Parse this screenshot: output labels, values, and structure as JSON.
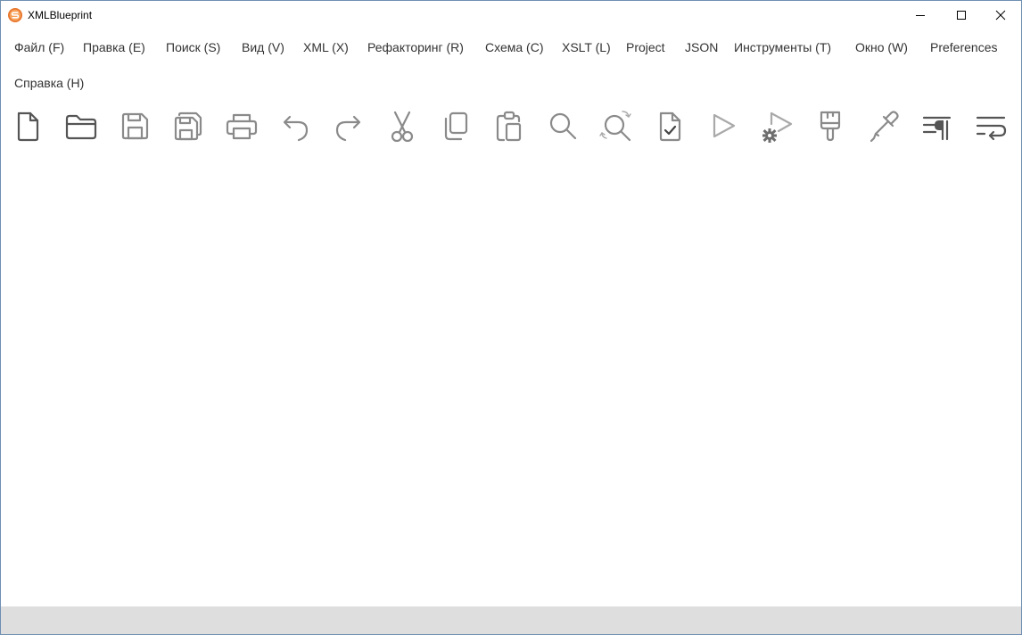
{
  "window": {
    "title": "XMLBlueprint",
    "accent_color": "#e8762c"
  },
  "menu": {
    "items": [
      {
        "label": "Файл (F)"
      },
      {
        "label": "Правка (E)"
      },
      {
        "label": "Поиск (S)"
      },
      {
        "label": "Вид (V)"
      },
      {
        "label": "XML (X)"
      },
      {
        "label": "Рефакторинг (R)"
      },
      {
        "label": "Схема (C)"
      },
      {
        "label": "XSLT (L)"
      },
      {
        "label": "Project"
      },
      {
        "label": "JSON"
      },
      {
        "label": "Инструменты (T)"
      },
      {
        "label": "Окно (W)"
      },
      {
        "label": "Preferences"
      },
      {
        "label": "Справка (H)"
      }
    ]
  },
  "toolbar": {
    "icons": [
      "new-file-icon",
      "open-folder-icon",
      "save-icon",
      "save-all-icon",
      "print-icon",
      "undo-icon",
      "redo-icon",
      "cut-icon",
      "copy-icon",
      "paste-icon",
      "find-icon",
      "find-replace-icon",
      "validate-icon",
      "run-icon",
      "run-settings-icon",
      "format-brush-icon",
      "eyedropper-icon",
      "show-whitespace-icon",
      "word-wrap-icon"
    ]
  },
  "statusbar": {
    "background": "#dedede"
  }
}
